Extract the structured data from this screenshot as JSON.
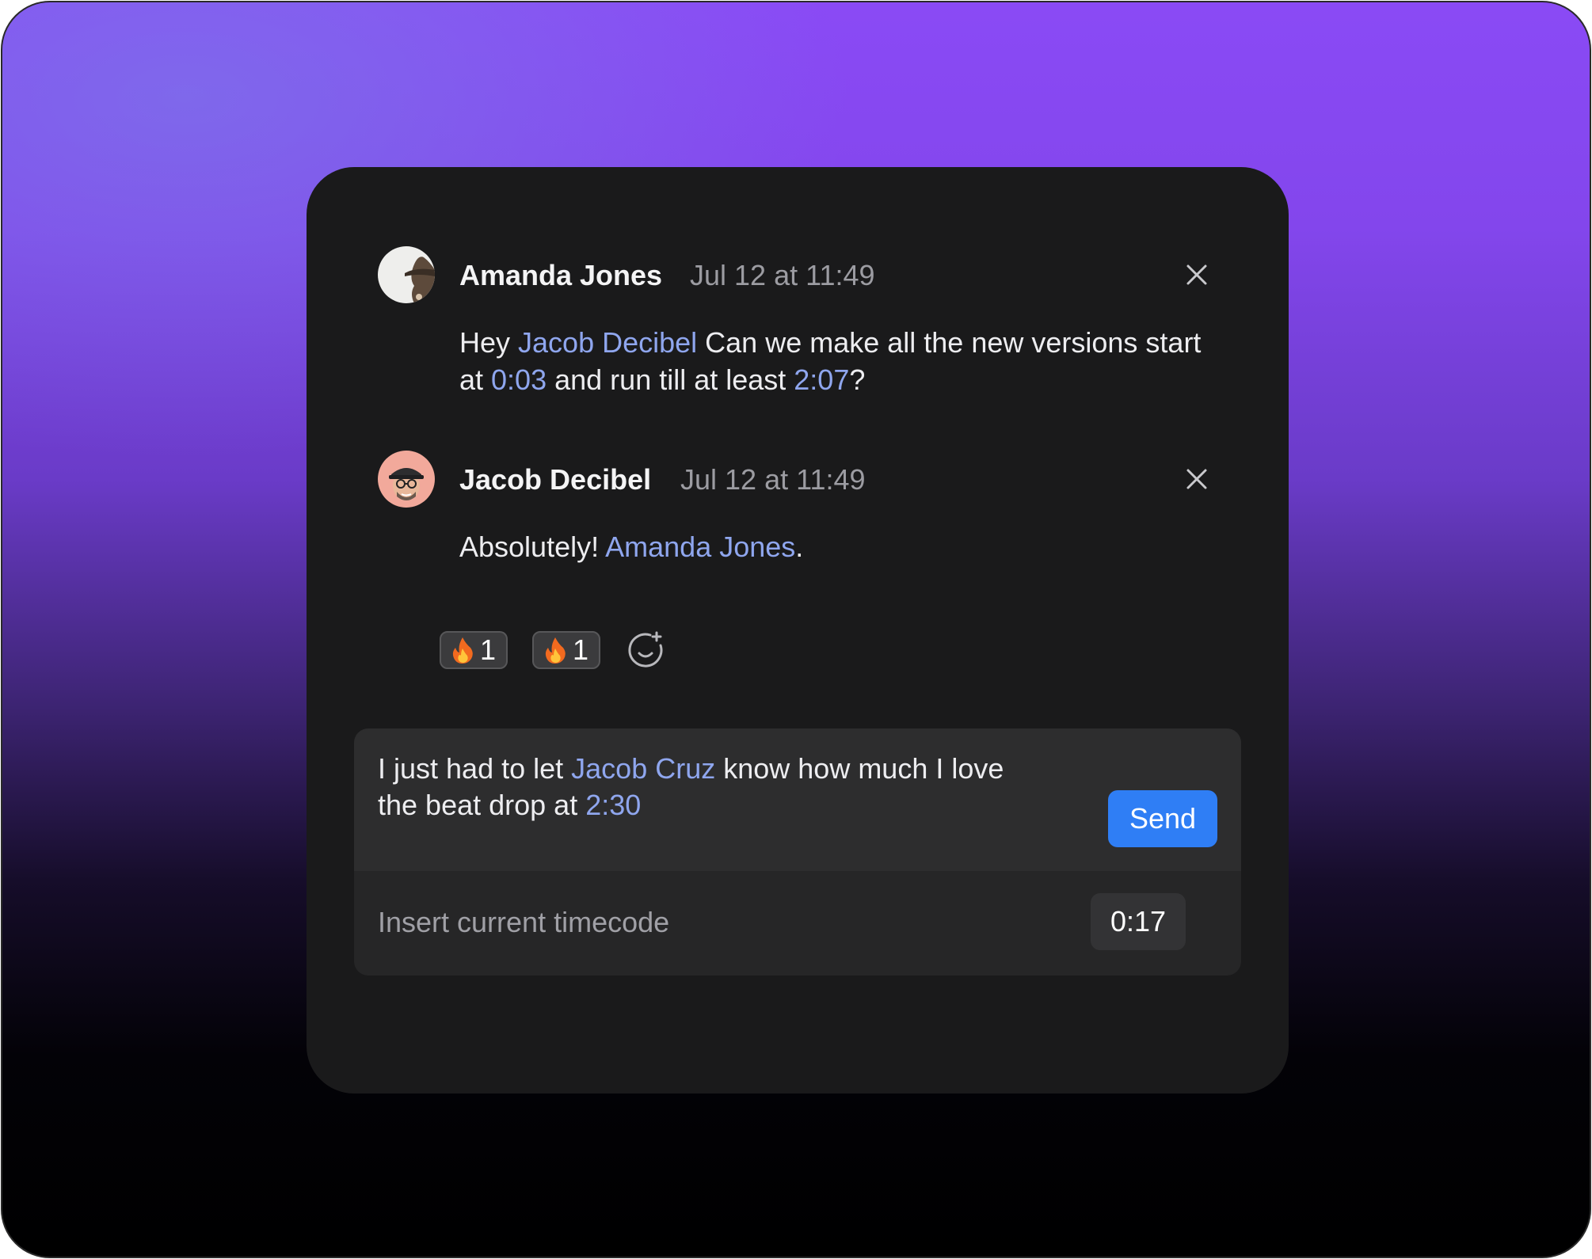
{
  "comments": [
    {
      "author": "Amanda Jones",
      "timestamp": "Jul 12 at 11:49",
      "body": {
        "t1": "Hey ",
        "mention": "Jacob Decibel",
        "t2": " Can we make all the new versions start at ",
        "timecode_1": "0:03",
        "t3": " and run till at least ",
        "timecode_2": "2:07",
        "t4": "?"
      }
    },
    {
      "author": "Jacob Decibel",
      "timestamp": "Jul 12 at 11:49",
      "body": {
        "t1": "Absolutely! ",
        "mention": "Amanda Jones",
        "t2": "."
      },
      "reactions": [
        {
          "icon": "fire-emoji-icon",
          "count": "1"
        },
        {
          "icon": "fire-emoji-icon",
          "count": "1"
        }
      ],
      "add_reaction_icon": "add-reaction-icon"
    }
  ],
  "composer": {
    "draft": {
      "t1": "I just had to let ",
      "mention": "Jacob Cruz",
      "t2": " know how much I love the beat drop at ",
      "timecode": "2:30"
    },
    "send_label": "Send",
    "insert_timecode_label": "Insert current timecode",
    "current_timecode": "0:17"
  },
  "colors": {
    "accent_blue": "#2f7ef5",
    "link": "#8fa6ee",
    "card_bg": "#1a1a1b",
    "gradient_top": "#8a4af5",
    "gradient_bottom": "#000000"
  }
}
